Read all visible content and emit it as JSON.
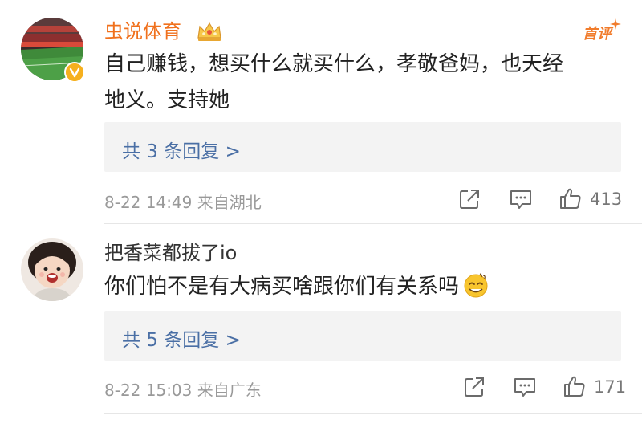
{
  "comments": [
    {
      "username": "虫说体育",
      "username_color": "#f0701c",
      "verified": true,
      "badge": "首评",
      "text_lines": [
        "自己赚钱，想买什么就买什么，孝敬爸妈，也天经",
        "地义。支持她"
      ],
      "replies_label": "共 3 条回复 >",
      "timestamp": "8-22 14:49",
      "location": "来自湖北",
      "likes": "413"
    },
    {
      "username": "把香菜都拔了io",
      "username_color": "#333333",
      "verified": false,
      "text_lines": [
        "你们怕不是有大病买啥跟你们有关系吗"
      ],
      "emoji": "sweat-smile-emoji",
      "replies_label": "共 5 条回复 >",
      "timestamp": "8-22 15:03",
      "location": "来自广东",
      "likes": "171"
    }
  ],
  "colors": {
    "link": "#4a6fa5",
    "meta": "#999999",
    "reply_bg": "#f3f3f3",
    "badge": "#f17c2c",
    "verified": "#f6b01e"
  }
}
